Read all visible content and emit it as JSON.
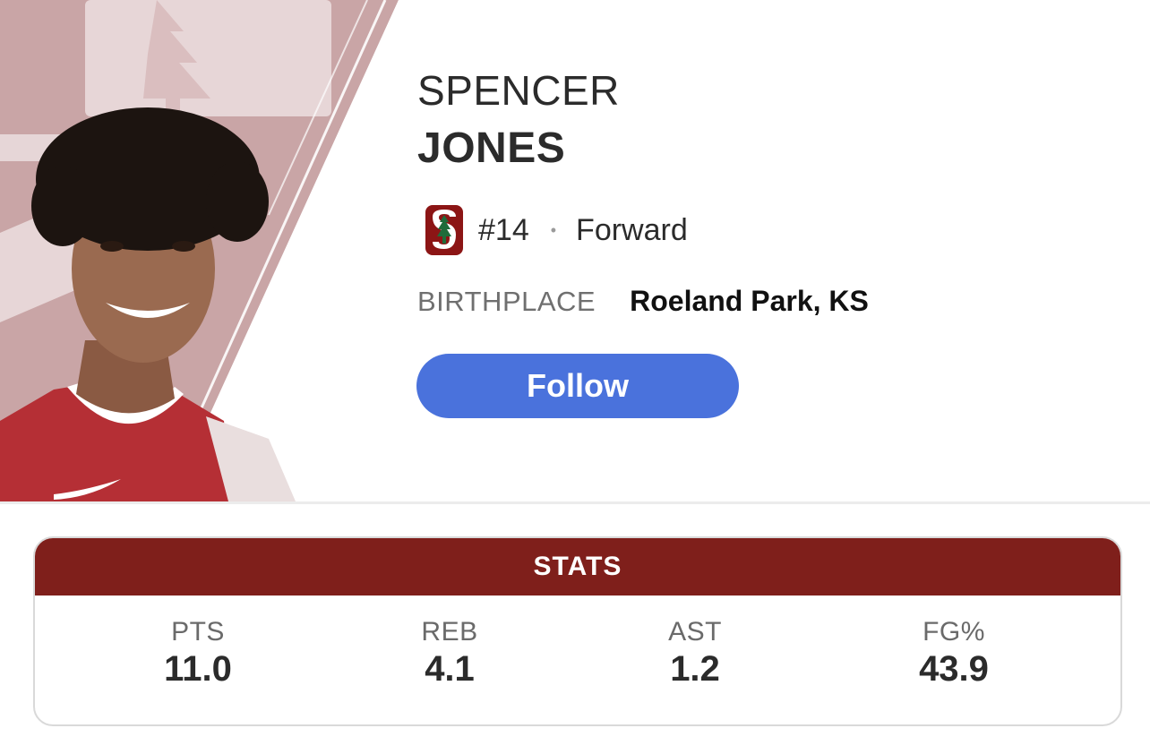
{
  "player": {
    "first_name": "SPENCER",
    "last_name": "JONES",
    "jersey": "#14",
    "separator": "•",
    "position": "Forward",
    "birthplace_label": "BIRTHPLACE",
    "birthplace_value": "Roeland Park, KS",
    "team_logo_icon": "stanford-tree-logo-icon",
    "photo_icon": "player-headshot"
  },
  "follow_button": {
    "label": "Follow",
    "color": "#4a72dc"
  },
  "stats": {
    "header": "STATS",
    "header_color": "#7f1f1b",
    "items": [
      {
        "label": "PTS",
        "value": "11.0"
      },
      {
        "label": "REB",
        "value": "4.1"
      },
      {
        "label": "AST",
        "value": "1.2"
      },
      {
        "label": "FG%",
        "value": "43.9"
      }
    ]
  }
}
